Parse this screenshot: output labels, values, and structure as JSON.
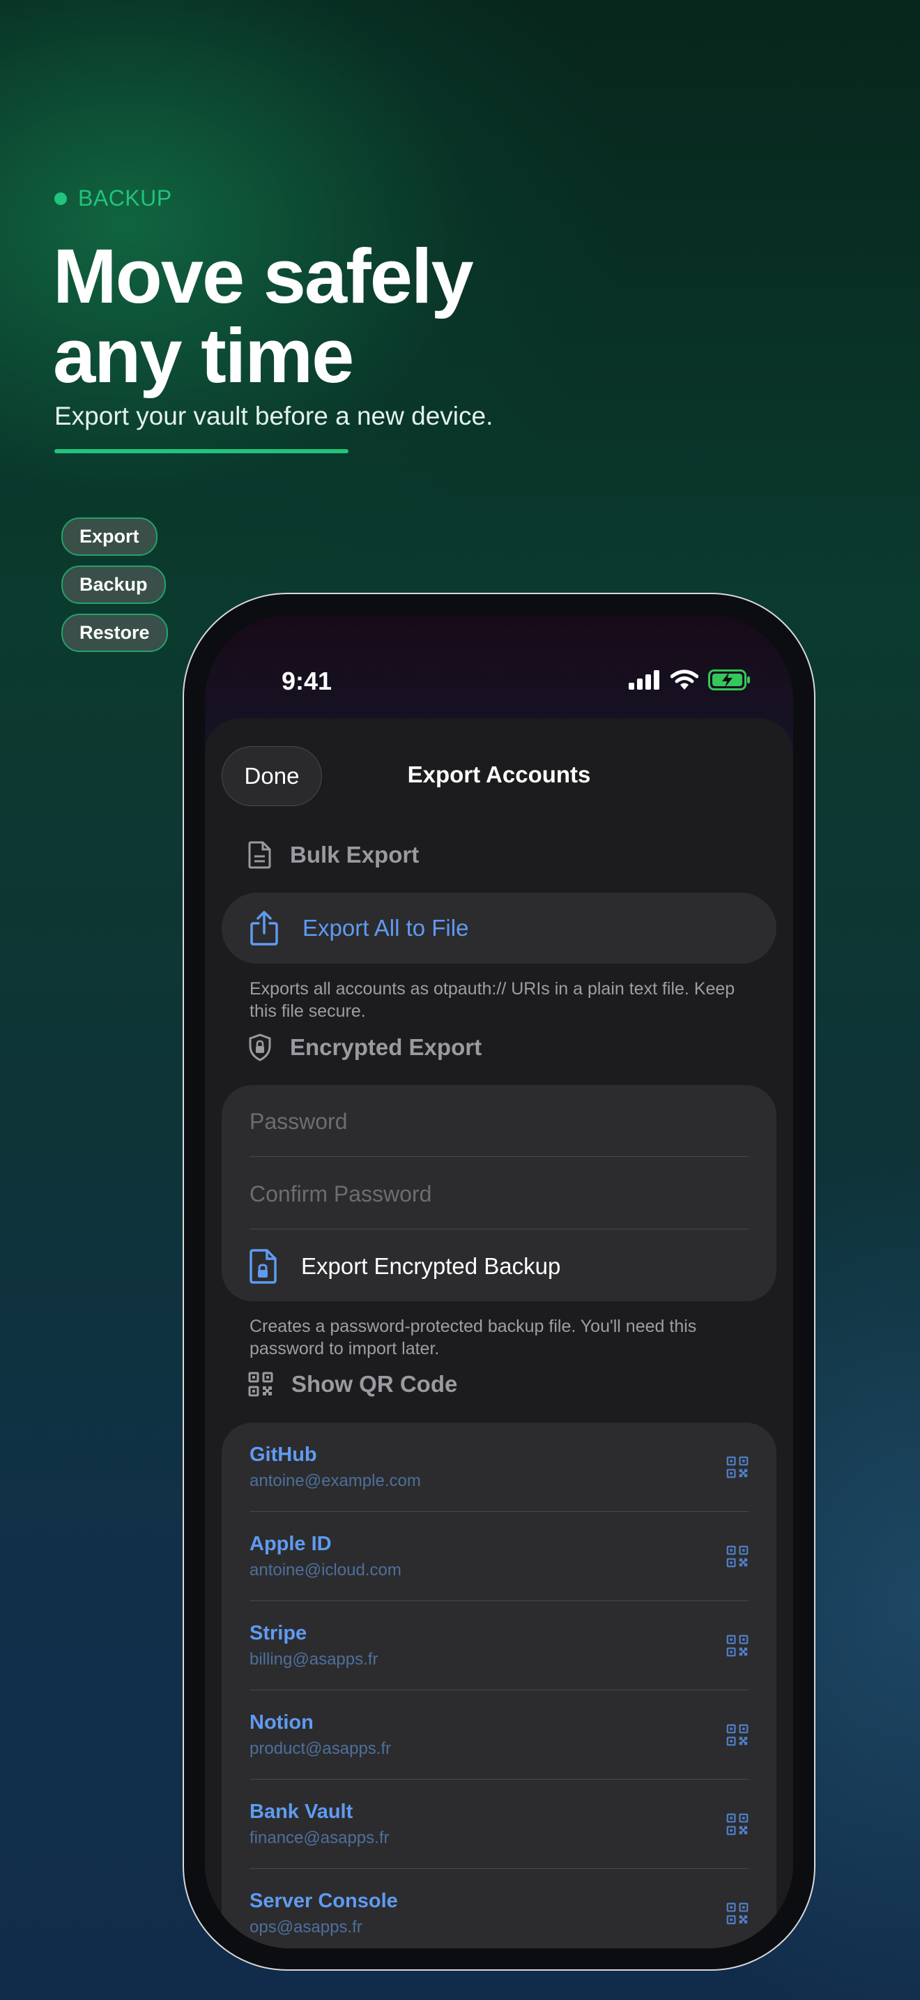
{
  "promo": {
    "eyebrow": "BACKUP",
    "headline_line1": "Move safely",
    "headline_line2": "any time",
    "subhead": "Export your vault before a new device.",
    "chips": [
      "Export",
      "Backup",
      "Restore"
    ],
    "accent_color": "#22c37a"
  },
  "status_bar": {
    "time": "9:41",
    "battery_color": "#34c759",
    "icons": [
      "cellular-signal-icon",
      "wifi-icon",
      "battery-charging-icon"
    ]
  },
  "sheet": {
    "done_label": "Done",
    "title": "Export Accounts"
  },
  "bulk": {
    "heading": "Bulk Export",
    "action": "Export All to File",
    "footnote": "Exports all accounts as otpauth:// URIs in a plain text file. Keep this file secure."
  },
  "encrypted": {
    "heading": "Encrypted Export",
    "password_placeholder": "Password",
    "confirm_placeholder": "Confirm Password",
    "action": "Export Encrypted Backup",
    "footnote": "Creates a password-protected backup file. You'll need this password to import later."
  },
  "qr": {
    "heading": "Show QR Code",
    "accounts": [
      {
        "name": "GitHub",
        "email": "antoine@example.com"
      },
      {
        "name": "Apple ID",
        "email": "antoine@icloud.com"
      },
      {
        "name": "Stripe",
        "email": "billing@asapps.fr"
      },
      {
        "name": "Notion",
        "email": "product@asapps.fr"
      },
      {
        "name": "Bank Vault",
        "email": "finance@asapps.fr"
      },
      {
        "name": "Server Console",
        "email": "ops@asapps.fr"
      }
    ]
  },
  "colors": {
    "link_blue": "#5f9bf2",
    "card_bg": "#2c2c2e",
    "sheet_bg": "#1c1c1e"
  }
}
